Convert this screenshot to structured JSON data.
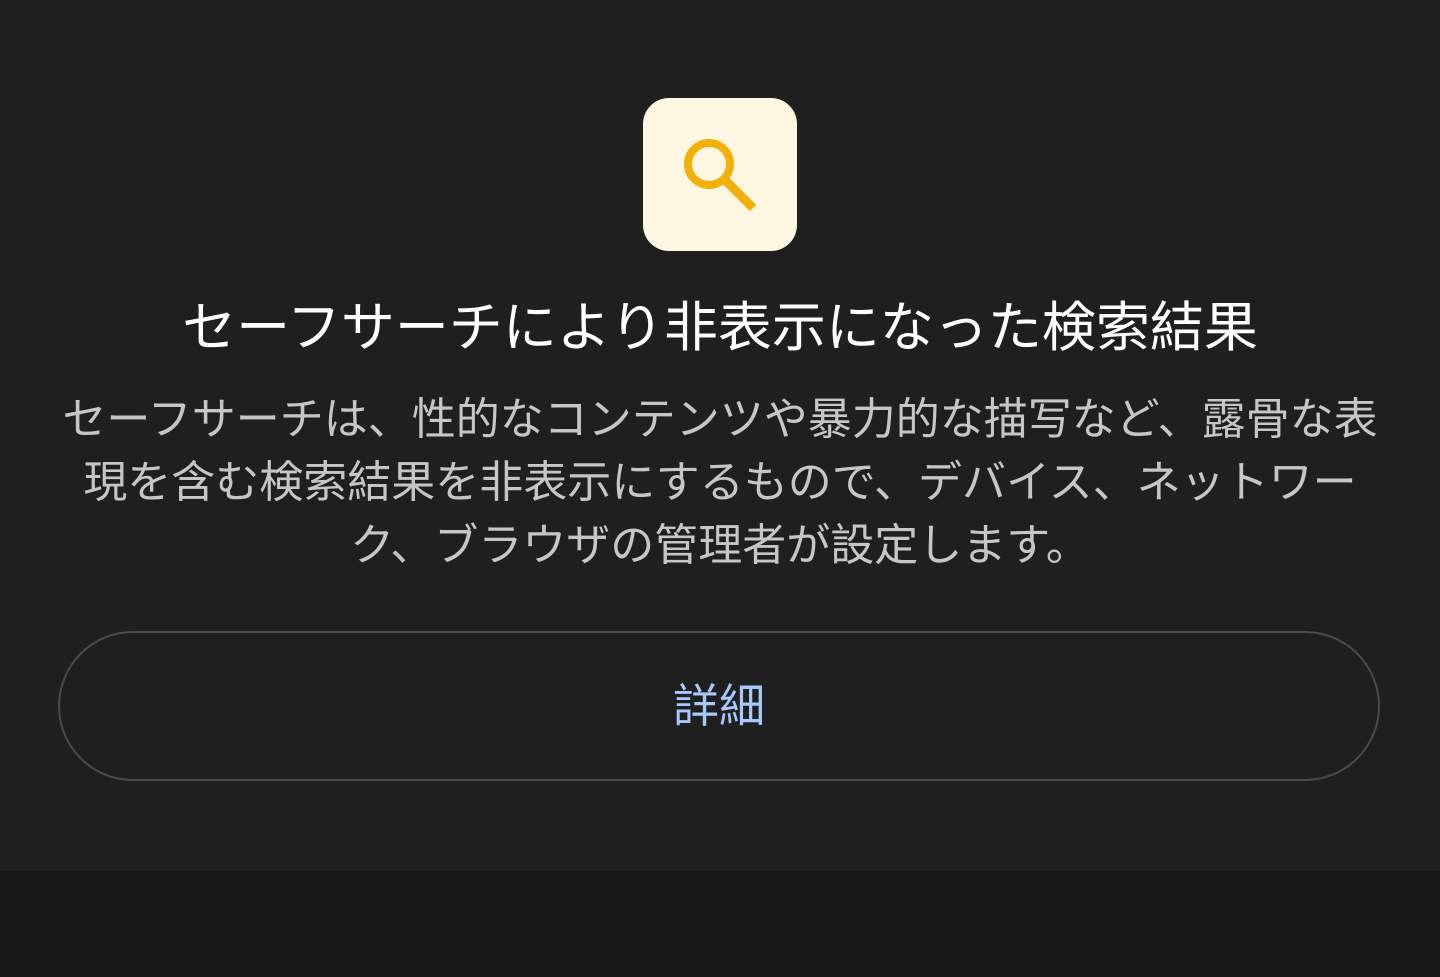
{
  "colors": {
    "panel_bg": "#1f1f1f",
    "page_bg": "#171717",
    "icon_tile_bg": "#fdf6e1",
    "icon_color": "#f2b10a",
    "title_color": "#ffffff",
    "body_text_color": "#c4c7c5",
    "button_text_color": "#a8c7fa",
    "button_border": "#4a4a4a"
  },
  "icon": {
    "name": "search-icon"
  },
  "safesearch": {
    "title": "セーフサーチにより非表示になった検索結果",
    "description": "セーフサーチは、性的なコンテンツや暴力的な描写など、露骨な表現を含む検索結果を非表示にするもので、デバイス、ネットワーク、ブラウザの管理者が設定します。",
    "details_button_label": "詳細"
  }
}
